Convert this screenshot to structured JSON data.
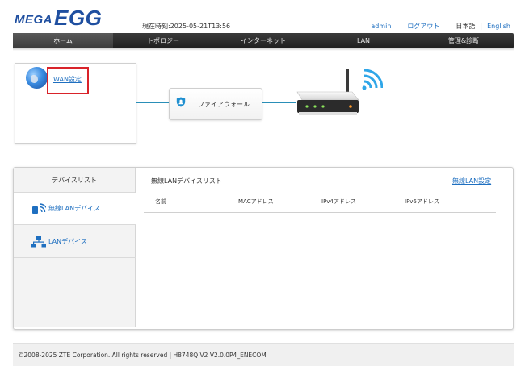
{
  "header": {
    "logo_mega": "MEGA",
    "logo_egg": "EGG",
    "time": "現在時刻:2025-05-21T13:56",
    "user": "admin",
    "logout": "ログアウト",
    "lang_ja": "日本語",
    "lang_sep": "|",
    "lang_en": "English"
  },
  "nav": {
    "tabs": [
      {
        "label": "ホーム"
      },
      {
        "label": "トポロジー"
      },
      {
        "label": "インターネット"
      },
      {
        "label": "LAN"
      },
      {
        "label": "管理&診断"
      }
    ]
  },
  "topology": {
    "wan_link": "WAN設定",
    "firewall": "ファイアウォール"
  },
  "devices": {
    "sidebar_title": "デバイスリスト",
    "items": [
      {
        "label": "無線LANデバイス"
      },
      {
        "label": "LANデバイス"
      }
    ],
    "content_title": "無線LANデバイスリスト",
    "settings_link": "無線LAN設定",
    "columns": [
      "名前",
      "MACアドレス",
      "IPv4アドレス",
      "IPv6アドレス"
    ]
  },
  "footer": {
    "text": "©2008-2025 ZTE Corporation. All rights reserved  |   H8748Q V2 V2.0.0P4_ENECOM"
  },
  "colors": {
    "accent_link": "#1e6fc0",
    "nav_bg": "#2a2a2a",
    "highlight": "#d9232a",
    "connector": "#2a8fb8"
  }
}
